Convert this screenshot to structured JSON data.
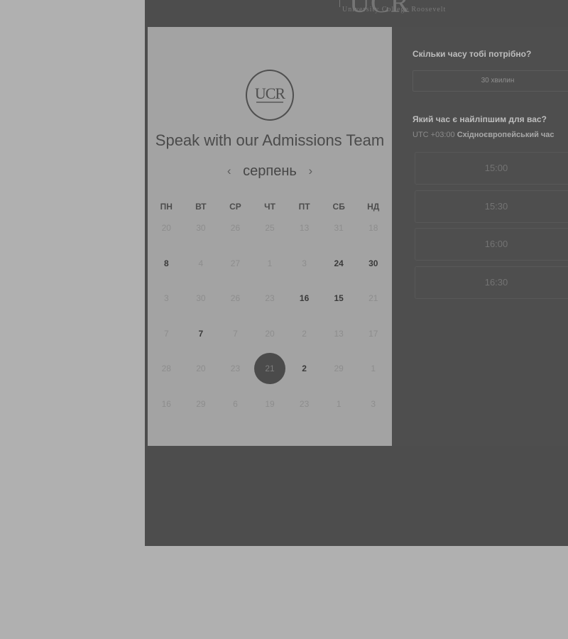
{
  "header": {
    "logo_text": "UCR",
    "logo_subtitle": "University College Roosevelt"
  },
  "calendar": {
    "emblem_text": "UCR",
    "title": "Speak with our Admissions Team",
    "month": "серпень",
    "prev_icon": "chevron-left-icon",
    "next_icon": "chevron-right-icon",
    "weekdays": [
      "ПН",
      "ВТ",
      "СР",
      "ЧТ",
      "ПТ",
      "СБ",
      "НД"
    ],
    "weeks": [
      [
        "20",
        "30",
        "26",
        "25",
        "13",
        "31",
        "18"
      ],
      [
        "8",
        "4",
        "27",
        "1",
        "3",
        "24",
        "30"
      ],
      [
        "3",
        "30",
        "26",
        "23",
        "16",
        "15",
        "21"
      ],
      [
        "7",
        "7",
        "7",
        "20",
        "2",
        "13",
        "17"
      ],
      [
        "28",
        "20",
        "23",
        "21",
        "2",
        "29",
        "1"
      ],
      [
        "16",
        "29",
        "6",
        "19",
        "23",
        "1",
        "3"
      ]
    ]
  },
  "booking": {
    "duration_label": "Скільки часу тобі потрібно?",
    "duration_value": "30 хвилин",
    "time_label": "Який час є найліпшим для вас?",
    "timezone_offset": "UTC +03:00",
    "timezone_name": "Східноєвропейський час",
    "slots": [
      "15:00",
      "15:30",
      "16:00",
      "16:30"
    ]
  }
}
